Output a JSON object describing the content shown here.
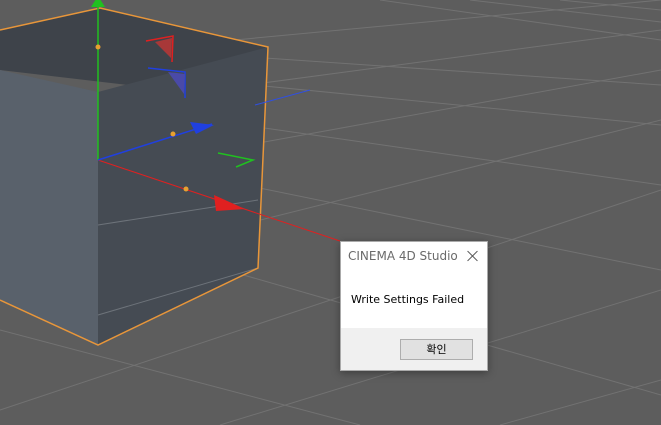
{
  "viewport": {
    "background": "#5d5d5d",
    "grid_color": "#6f6f6f",
    "cube_front": "#4a5058",
    "cube_left": "#59616b",
    "cube_top": "#3e434a",
    "cube_edge": "#e8963a",
    "axis_x_color": "#e02020",
    "axis_y_color": "#20c020",
    "axis_z_color": "#2040e0"
  },
  "dialog": {
    "title": "CINEMA 4D Studio",
    "message": "Write Settings Failed",
    "ok_label": "확인",
    "close_icon": "close-icon"
  }
}
